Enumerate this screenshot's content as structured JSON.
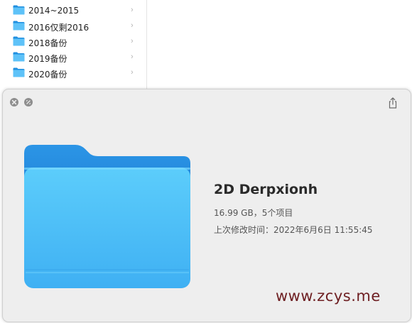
{
  "finder": {
    "items": [
      {
        "label": "2014~2015",
        "icon": "folder-icon"
      },
      {
        "label": "2016仅剩2016",
        "icon": "folder-icon"
      },
      {
        "label": "2018备份",
        "icon": "folder-icon"
      },
      {
        "label": "2019备份",
        "icon": "folder-icon"
      },
      {
        "label": "2020备份",
        "icon": "folder-icon"
      }
    ],
    "chevron": "›"
  },
  "quicklook": {
    "title": "2D Derpxionh",
    "size_info": "16.99 GB，5个项目",
    "modified": "上次修改时间：2022年6月6日 11:55:45",
    "close_icon": "close-icon",
    "fullscreen_icon": "fullscreen-icon",
    "share_icon": "share-icon",
    "preview_icon": "folder-icon",
    "folder_color": "#49b8f5"
  },
  "watermark": "www.zcys.me"
}
